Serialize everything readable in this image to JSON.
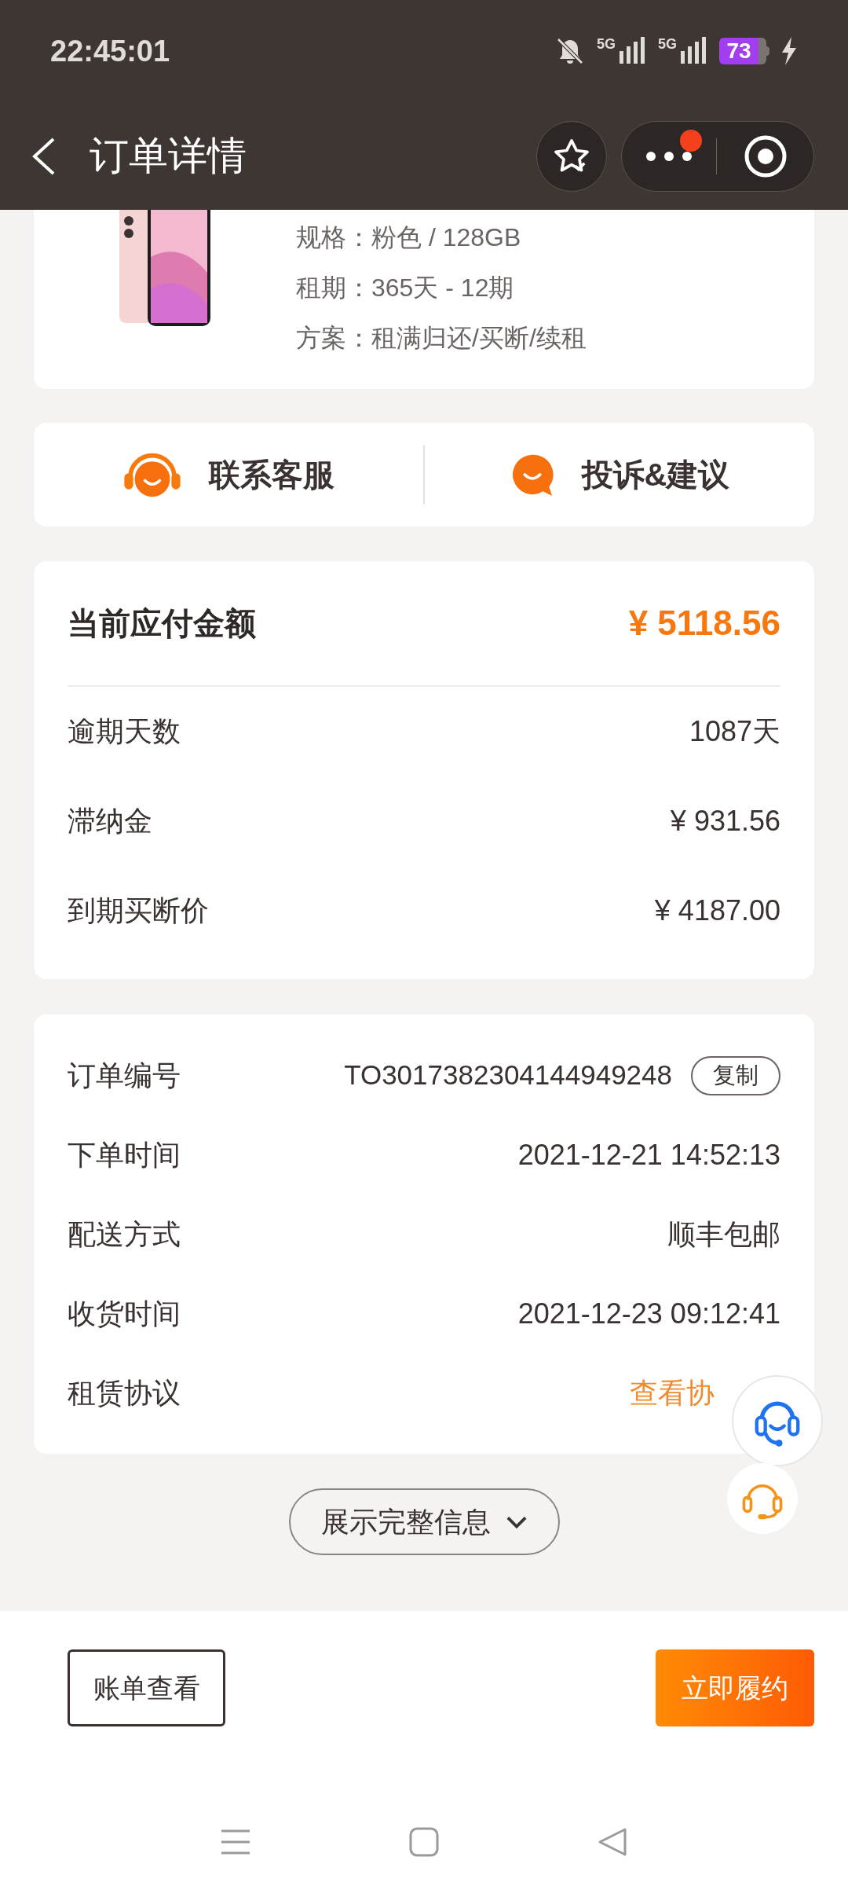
{
  "status_bar": {
    "time": "22:45:01",
    "battery": "73",
    "network_1": "5G",
    "network_2": "5G",
    "muted": true,
    "charging": true
  },
  "header": {
    "title": "订单详情",
    "more_badge": true
  },
  "product": {
    "specs": [
      {
        "label": "规格：",
        "value": "粉色 / 128GB"
      },
      {
        "label": "租期：",
        "value": "365天 - 12期"
      },
      {
        "label": "方案：",
        "value": "租满归还/买断/续租"
      }
    ]
  },
  "service_actions": [
    {
      "kind": "headset",
      "label": "联系客服"
    },
    {
      "kind": "chat",
      "label": "投诉&建议"
    }
  ],
  "payment": {
    "title": "当前应付金额",
    "amount": "¥ 5118.56",
    "rows": [
      {
        "label": "逾期天数",
        "value": "1087天"
      },
      {
        "label": "滞纳金",
        "value": "¥ 931.56"
      },
      {
        "label": "到期买断价",
        "value": "¥ 4187.00"
      }
    ]
  },
  "order_info": [
    {
      "kind": "copy",
      "label": "订单编号",
      "value": "TO3017382304144949248",
      "action": "复制"
    },
    {
      "kind": "text",
      "label": "下单时间",
      "value": "2021-12-21 14:52:13"
    },
    {
      "kind": "text",
      "label": "配送方式",
      "value": "顺丰包邮"
    },
    {
      "kind": "text",
      "label": "收货时间",
      "value": "2021-12-23 09:12:41"
    },
    {
      "kind": "link",
      "label": "租赁协议",
      "value": "查看协"
    }
  ],
  "expand_button": "展示完整信息",
  "footer_buttons": [
    {
      "kind": "outline",
      "label": "账单查看"
    },
    {
      "kind": "primary",
      "label": "立即履约"
    }
  ]
}
